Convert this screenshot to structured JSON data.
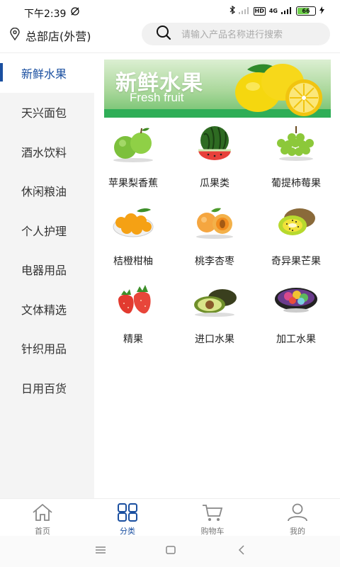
{
  "status_bar": {
    "time": "下午2:39",
    "signal1": "4G",
    "hd": "HD",
    "battery": "66"
  },
  "header": {
    "store_name": "总部店(外营)",
    "search_placeholder": "请输入产品名称进行搜索"
  },
  "sidebar": {
    "items": [
      {
        "label": "新鲜水果",
        "active": true
      },
      {
        "label": "天兴面包",
        "active": false
      },
      {
        "label": "酒水饮料",
        "active": false
      },
      {
        "label": "休闲粮油",
        "active": false
      },
      {
        "label": "个人护理",
        "active": false
      },
      {
        "label": "电器用品",
        "active": false
      },
      {
        "label": "文体精选",
        "active": false
      },
      {
        "label": "针织用品",
        "active": false
      },
      {
        "label": "日用百货",
        "active": false
      }
    ]
  },
  "banner": {
    "title": "新鲜水果",
    "subtitle": "Fresh fruit"
  },
  "categories": [
    {
      "label": "苹果梨香蕉",
      "icon": "apple-icon"
    },
    {
      "label": "瓜果类",
      "icon": "watermelon-icon"
    },
    {
      "label": "葡提柿莓果",
      "icon": "grape-icon"
    },
    {
      "label": "桔橙柑柚",
      "icon": "orange-icon"
    },
    {
      "label": "桃李杏枣",
      "icon": "apricot-icon"
    },
    {
      "label": "奇异果芒果",
      "icon": "kiwi-icon"
    },
    {
      "label": "精果",
      "icon": "strawberry-icon"
    },
    {
      "label": "进口水果",
      "icon": "avocado-icon"
    },
    {
      "label": "加工水果",
      "icon": "fruit-bowl-icon"
    }
  ],
  "tabbar": {
    "items": [
      {
        "label": "首页",
        "icon": "home-icon",
        "active": false
      },
      {
        "label": "分类",
        "icon": "category-icon",
        "active": true
      },
      {
        "label": "购物车",
        "icon": "cart-icon",
        "active": false
      },
      {
        "label": "我的",
        "icon": "user-icon",
        "active": false
      }
    ]
  },
  "colors": {
    "accent": "#1a4fa0",
    "sidebar_bg": "#f4f4f4",
    "banner_green": "#2fae57"
  }
}
